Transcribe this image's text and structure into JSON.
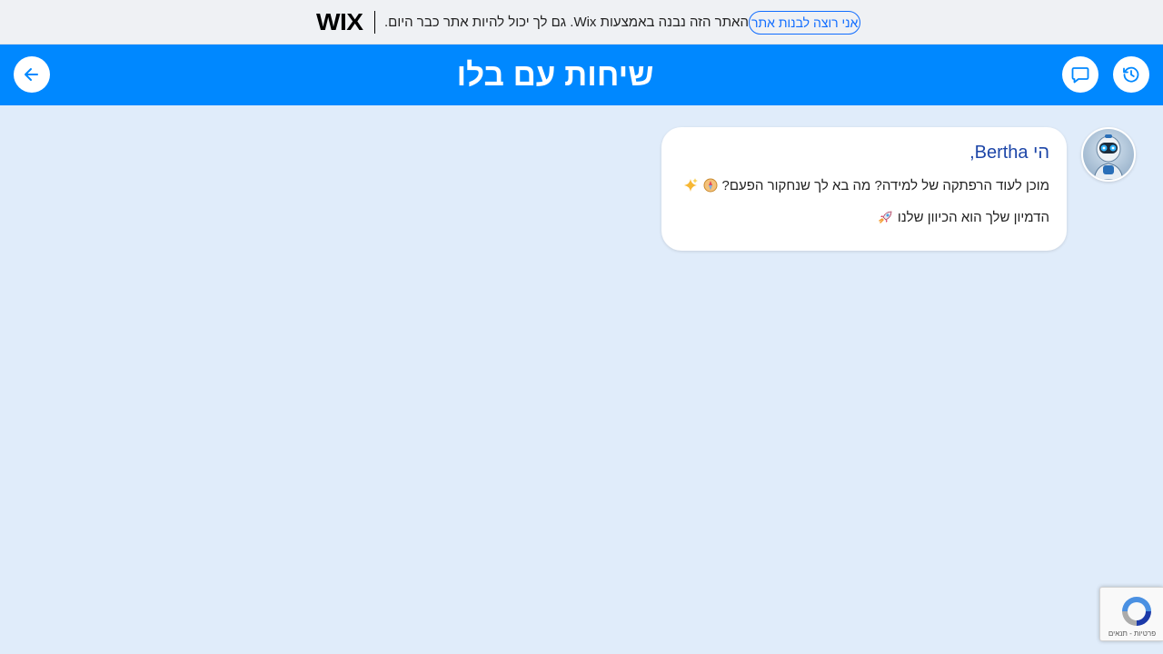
{
  "wix_banner": {
    "logo": "WIX",
    "message": "האתר הזה נבנה באמצעות Wix. גם לך יכול להיות אתר כבר היום.",
    "cta_label": "אני רוצה לבנות אתר"
  },
  "header": {
    "title": "שיחות עם בלו",
    "back_icon": "arrow-left-icon",
    "chat_icon": "chat-bubble-icon",
    "history_icon": "history-icon",
    "bg_color": "#0088ff"
  },
  "message": {
    "greeting": "הי Bertha,",
    "line1": "מוכן לעוד הרפתקה של למידה? מה בא לך שנחקור הפעם?",
    "line1_emojis": [
      "compass",
      "sparkles"
    ],
    "line2": "הדמיון שלך הוא הכיוון שלנו",
    "line2_emojis": [
      "rocket"
    ],
    "accent_color": "#1d46a8"
  },
  "recaptcha": {
    "links": "פרטיות - תנאים"
  }
}
